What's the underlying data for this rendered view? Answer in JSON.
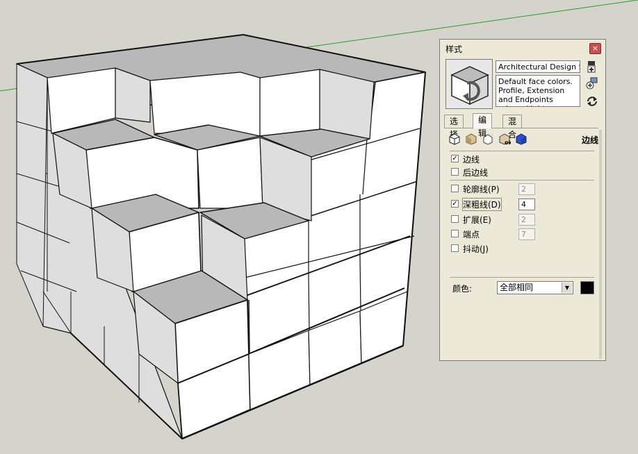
{
  "panel": {
    "title": "样式",
    "close_glyph": "×",
    "style_name": "Architectural Design Style",
    "style_description": "Default face colors. Profile, Extension and Endpoints edges. Light",
    "tabs": [
      {
        "label": "选择",
        "active": false
      },
      {
        "label": "编辑",
        "active": true
      },
      {
        "label": "混合",
        "active": false
      }
    ],
    "section_title": "边线",
    "category_icons": [
      "edge-settings-icon",
      "face-settings-icon",
      "background-settings-icon",
      "watermark-settings-icon",
      "modeling-settings-icon"
    ],
    "edges": {
      "edges": {
        "label": "边线",
        "checked": true
      },
      "back_edges": {
        "label": "后边线",
        "checked": false
      },
      "profiles": {
        "label": "轮廓线(P)",
        "checked": false,
        "value": "2",
        "enabled": false
      },
      "depth_cue": {
        "label": "深粗线(D)",
        "checked": true,
        "value": "4",
        "enabled": true
      },
      "extension": {
        "label": "扩展(E)",
        "checked": false,
        "value": "2",
        "enabled": false
      },
      "endpoints": {
        "label": "端点",
        "checked": false,
        "value": "7",
        "enabled": false
      },
      "jitter": {
        "label": "抖动(J)",
        "checked": false
      }
    },
    "color": {
      "label": "颜色:",
      "selected": "全部相同",
      "swatch": "#000000"
    }
  },
  "scene": {
    "background": "#d4d4cc",
    "axis_color": "#2a9a2a",
    "top_face_color": "#b8b8b8",
    "side_face_color": "#dedede",
    "front_face_color": "#ffffff"
  }
}
